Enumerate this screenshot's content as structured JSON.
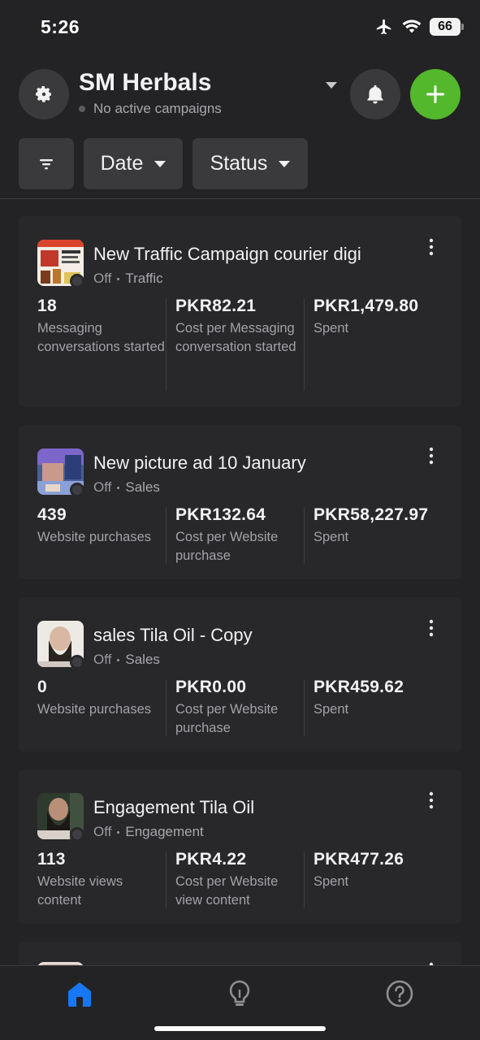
{
  "status_bar": {
    "time": "5:26",
    "battery": "66"
  },
  "header": {
    "account_name": "SM Herbals",
    "account_status": "No active campaigns"
  },
  "filters": {
    "date_label": "Date",
    "status_label": "Status"
  },
  "campaigns": [
    {
      "name": "New Traffic Campaign courier digi",
      "status": "Off",
      "objective": "Traffic",
      "metrics": [
        {
          "value": "18",
          "label": "Messaging conversations started"
        },
        {
          "value": "PKR82.21",
          "label": "Cost per Messaging conversation started"
        },
        {
          "value": "PKR1,479.80",
          "label": "Spent"
        }
      ]
    },
    {
      "name": "New picture ad 10 January",
      "status": "Off",
      "objective": "Sales",
      "metrics": [
        {
          "value": "439",
          "label": "Website purchases"
        },
        {
          "value": "PKR132.64",
          "label": "Cost per Website purchase"
        },
        {
          "value": "PKR58,227.97",
          "label": "Spent"
        }
      ]
    },
    {
      "name": "sales Tila Oil - Copy",
      "status": "Off",
      "objective": "Sales",
      "metrics": [
        {
          "value": "0",
          "label": "Website purchases"
        },
        {
          "value": "PKR0.00",
          "label": "Cost per Website purchase"
        },
        {
          "value": "PKR459.62",
          "label": "Spent"
        }
      ]
    },
    {
      "name": "Engagement Tila Oil",
      "status": "Off",
      "objective": "Engagement",
      "metrics": [
        {
          "value": "113",
          "label": "Website views content"
        },
        {
          "value": "PKR4.22",
          "label": "Cost per Website view content"
        },
        {
          "value": "PKR477.26",
          "label": "Spent"
        }
      ]
    }
  ],
  "icons": {
    "settings": "gear-icon",
    "notifications": "bell-icon",
    "create": "plus-icon",
    "filter": "filter-icon",
    "home": "home-icon",
    "insights": "lightbulb-icon",
    "help": "help-icon"
  },
  "colors": {
    "background": "#232325",
    "card": "#28282b",
    "accent_green": "#53b82b",
    "active_nav_blue": "#1877f2"
  }
}
